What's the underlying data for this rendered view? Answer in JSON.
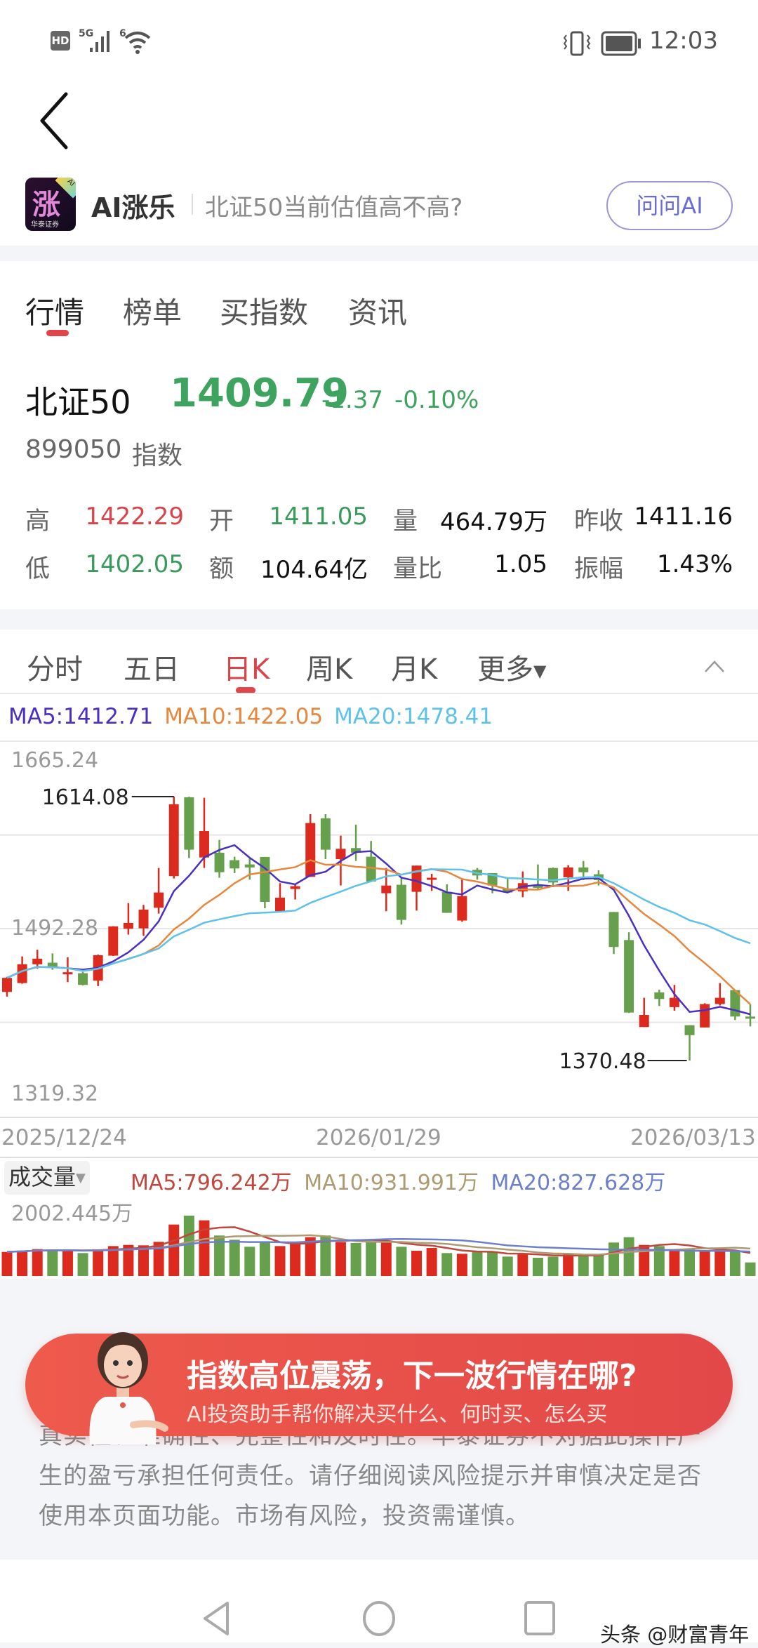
{
  "status_bar": {
    "left_badges": [
      "HD",
      "5G",
      "6"
    ],
    "time": "12:03"
  },
  "ai_bar": {
    "logo_char": "涨",
    "logo_brand": "华泰证券",
    "logo_badge": "AI",
    "name": "AI涨乐",
    "question": "北证50当前估值高不高?",
    "ask_button": "问问AI"
  },
  "main_tabs": [
    {
      "label": "行情",
      "active": true
    },
    {
      "label": "榜单"
    },
    {
      "label": "买指数"
    },
    {
      "label": "资讯"
    }
  ],
  "quote": {
    "name": "北证50",
    "price": "1409.79",
    "change": "-1.37",
    "change_pct": "-0.10%",
    "code": "899050",
    "type": "指数",
    "stats": [
      {
        "label": "高",
        "value": "1422.29",
        "color": "#d9434a"
      },
      {
        "label": "开",
        "value": "1411.05",
        "color": "#3a9a5c"
      },
      {
        "label": "量",
        "value": "464.79万",
        "color": "#111"
      },
      {
        "label": "昨收",
        "value": "1411.16",
        "color": "#111"
      },
      {
        "label": "低",
        "value": "1402.05",
        "color": "#3a9a5c"
      },
      {
        "label": "额",
        "value": "104.64亿",
        "color": "#111"
      },
      {
        "label": "量比",
        "value": "1.05",
        "color": "#111"
      },
      {
        "label": "振幅",
        "value": "1.43%",
        "color": "#111"
      }
    ]
  },
  "period_tabs": [
    {
      "label": "分时"
    },
    {
      "label": "五日"
    },
    {
      "label": "日K",
      "active": true
    },
    {
      "label": "周K"
    },
    {
      "label": "月K"
    },
    {
      "label": "更多"
    }
  ],
  "ma_labels": {
    "ma5": "MA5:1412.71",
    "ma10": "MA10:1422.05",
    "ma20": "MA20:1478.41"
  },
  "volume_header": {
    "title": "成交量",
    "ma5": "MA5:796.242万",
    "ma10": "MA10:931.991万",
    "ma20": "MA20:827.628万",
    "max_label": "2002.445万"
  },
  "colors": {
    "up": "#dc2b1e",
    "down": "#66a04c",
    "ma5": "#4a2fc4",
    "ma10": "#e8873c",
    "ma20": "#5cc2ea",
    "vma5": "#c0463e",
    "vma10": "#ad9a70",
    "vma20": "#6b7fcb"
  },
  "chart_data": {
    "type": "candlestick",
    "y_ticks": [
      "1665.24",
      "1492.28",
      "1319.32"
    ],
    "ylim": [
      1319.32,
      1665.24
    ],
    "x_ticks": [
      "2025/12/24",
      "2026/01/29",
      "2026/03/13"
    ],
    "max_annotation": "1614.08",
    "min_annotation": "1370.48",
    "ohlc": [
      [
        1433.8,
        1446.8,
        1447.8,
        1429.5
      ],
      [
        1442.0,
        1459.3,
        1466.6,
        1441.4
      ],
      [
        1459.3,
        1464.5,
        1472.7,
        1455.4
      ],
      [
        1460.8,
        1456.0,
        1469.4,
        1454.3
      ],
      [
        1450.0,
        1452.0,
        1465.8,
        1442.9
      ],
      [
        1451.1,
        1440.3,
        1452.2,
        1439.8
      ],
      [
        1444.2,
        1467.7,
        1468.3,
        1439.2
      ],
      [
        1467.3,
        1494.3,
        1494.5,
        1467.0
      ],
      [
        1492.1,
        1497.5,
        1515.8,
        1486.7
      ],
      [
        1492.5,
        1509.8,
        1514.1,
        1485.6
      ],
      [
        1511.5,
        1525.6,
        1548.2,
        1506.1
      ],
      [
        1540.7,
        1607.0,
        1614.08,
        1538.5
      ],
      [
        1613.5,
        1565.1,
        1614.0,
        1557.3
      ],
      [
        1557.9,
        1582.3,
        1613.0,
        1548.2
      ],
      [
        1562.3,
        1544.3,
        1574.1,
        1539.2
      ],
      [
        1555.4,
        1547.8,
        1558.6,
        1543.5
      ],
      [
        1551.5,
        1548.7,
        1557.3,
        1537.4
      ],
      [
        1558.4,
        1516.9,
        1558.4,
        1511.1
      ],
      [
        1508.3,
        1520.8,
        1534.2,
        1508.3
      ],
      [
        1528.8,
        1531.4,
        1533.1,
        1519.1
      ],
      [
        1540.0,
        1589.7,
        1597.9,
        1540.0
      ],
      [
        1594.0,
        1565.1,
        1597.9,
        1556.4
      ],
      [
        1556.4,
        1565.9,
        1578.0,
        1532.0
      ],
      [
        1566.6,
        1562.3,
        1588.2,
        1554.7
      ],
      [
        1558.6,
        1535.7,
        1573.1,
        1535.7
      ],
      [
        1524.9,
        1532.0,
        1548.2,
        1508.3
      ],
      [
        1532.7,
        1500.3,
        1539.6,
        1496.0
      ],
      [
        1526.2,
        1550.4,
        1550.4,
        1508.9
      ],
      [
        1537.4,
        1539.2,
        1542.8,
        1527.1
      ],
      [
        1526.2,
        1506.8,
        1533.1,
        1506.8
      ],
      [
        1499.7,
        1522.3,
        1537.9,
        1498.6
      ],
      [
        1546.5,
        1541.3,
        1548.2,
        1537.4
      ],
      [
        1543.5,
        1532.0,
        1543.5,
        1524.9
      ],
      [
        1529.2,
        1525.6,
        1539.6,
        1524.9
      ],
      [
        1526.6,
        1534.2,
        1545.0,
        1521.2
      ],
      [
        1532.0,
        1529.9,
        1551.5,
        1528.8
      ],
      [
        1548.2,
        1534.8,
        1548.7,
        1532.0
      ],
      [
        1539.6,
        1548.7,
        1550.8,
        1527.1
      ],
      [
        1548.7,
        1544.3,
        1554.7,
        1537.0
      ],
      [
        1542.4,
        1537.0,
        1546.1,
        1532.0
      ],
      [
        1507.6,
        1475.3,
        1507.6,
        1468.8
      ],
      [
        1481.7,
        1414.8,
        1488.9,
        1414.4
      ],
      [
        1401.4,
        1412.6,
        1428.4,
        1401.4
      ],
      [
        1433.4,
        1427.3,
        1435.9,
        1420.8
      ],
      [
        1419.8,
        1428.4,
        1440.3,
        1416.5
      ],
      [
        1403.1,
        1393.9,
        1403.1,
        1370.48
      ],
      [
        1401.0,
        1422.6,
        1423.4,
        1401.0
      ],
      [
        1422.6,
        1428.4,
        1442.0,
        1421.3
      ],
      [
        1435.5,
        1411.1,
        1435.5,
        1407.9
      ],
      [
        1411.05,
        1409.79,
        1422.29,
        1402.05
      ]
    ],
    "volume_wan": [
      799,
      838,
      893,
      877,
      877,
      761,
      877,
      993,
      1032,
      1017,
      1133,
      1707,
      2002.445,
      1847,
      1343,
      1203,
      970,
      1110,
      993,
      1071,
      1288,
      1343,
      1125,
      1094,
      1149,
      1149,
      970,
      838,
      931,
      761,
      737,
      799,
      784,
      644,
      745,
      605,
      644,
      737,
      683,
      722,
      1110,
      1288,
      1032,
      993,
      877,
      877,
      838,
      815,
      838,
      450
    ],
    "volume_max": 2002.445
  },
  "promo_banner": {
    "title": "指数高位震荡，下一波行情在哪?",
    "subtitle": "AI投资助手帮你解决买什么、何时买、怎么买"
  },
  "disclaimer": [
    "真实性、准确性、完整性和及时性。华泰证券不对据此操作产",
    "生的盈亏承担任何责任。请仔细阅读风险提示并审慎决定是否",
    "使用本页面功能。市场有风险，投资需谨慎。"
  ],
  "watermark": "头条 @财富青年"
}
